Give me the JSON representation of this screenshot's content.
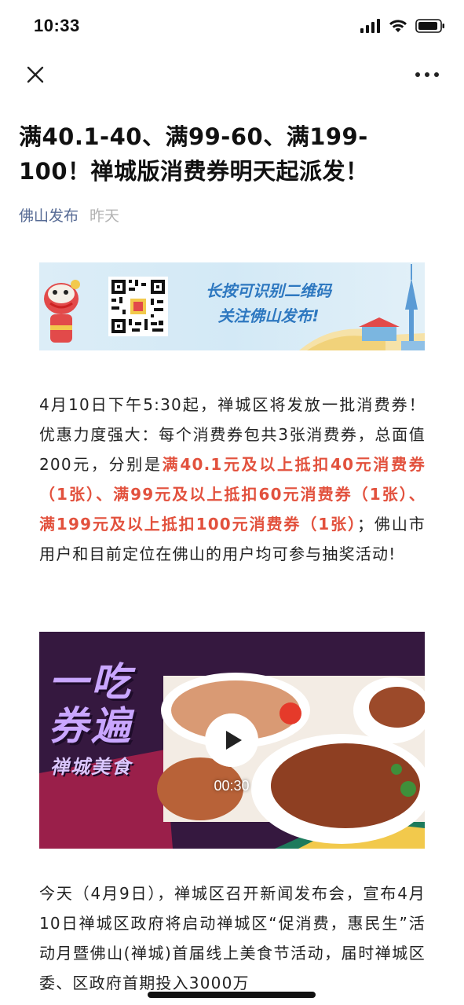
{
  "status_bar": {
    "time": "10:33"
  },
  "nav": {
    "close_icon": "close-icon",
    "more_icon": "more-icon"
  },
  "article": {
    "title": "满40.1-40、满99-60、满199-100！禅城版消费券明天起派发！",
    "account": "佛山发布",
    "date": "昨天"
  },
  "banner": {
    "line1": "长按可识别二维码",
    "line2": "关注佛山发布!"
  },
  "paragraph1": {
    "text_a": "4月10日下午5:30起，禅城区将发放一批消费券！优惠力度强大：每个消费券包共3张消费券，总面值200元，分别是",
    "highlight": "满40.1元及以上抵扣40元消费券（1张）、满99元及以上抵扣60元消费券（1张）、满199元及以上抵扣100元消费券（1张）",
    "text_b": "；佛山市用户和目前定位在佛山的用户均可参与抽奖活动!"
  },
  "video": {
    "title_line1": "一吃",
    "title_line2": "券遍",
    "subtitle": "禅城美食",
    "duration": "00:30"
  },
  "paragraph2": {
    "text": "今天（4月9日），禅城区召开新闻发布会，宣布4月10日禅城区政府将启动禅城区“促消费，惠民生”活动月暨佛山(禅城)首届线上美食节活动，届时禅城区委、区政府首期投入3000万"
  },
  "colors": {
    "accent_red": "#e2513d",
    "link_blue": "#576b95",
    "banner_blue": "#2e78c0"
  }
}
